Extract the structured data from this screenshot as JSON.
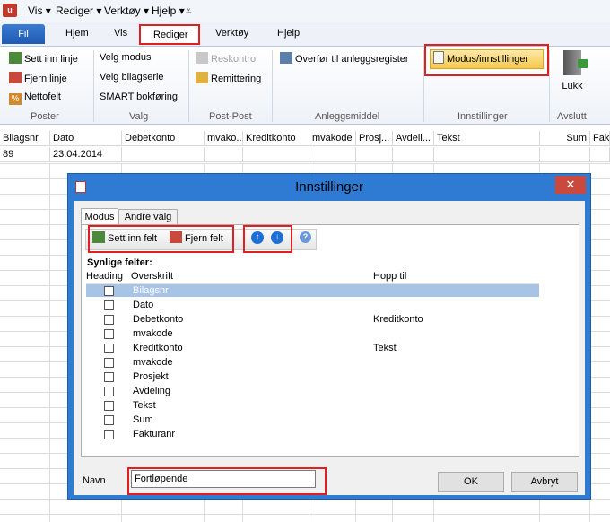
{
  "menu": {
    "vis": "Vis",
    "rediger": "Rediger",
    "verktoy": "Verktøy",
    "hjelp": "Hjelp"
  },
  "tabs": {
    "fil": "Fil",
    "hjem": "Hjem",
    "vis": "Vis",
    "rediger": "Rediger",
    "verktoy": "Verktøy",
    "hjelp": "Hjelp"
  },
  "ribbon": {
    "poster": {
      "label": "Poster",
      "sett_inn_linje": "Sett inn linje",
      "fjern_linje": "Fjern linje",
      "nettofelt": "Nettofelt"
    },
    "valg": {
      "label": "Valg",
      "velg_modus": "Velg modus",
      "velg_bilagserie": "Velg bilagserie",
      "smart": "SMART bokføring"
    },
    "post_post": {
      "label": "Post-Post",
      "reskontro": "Reskontro",
      "remittering": "Remittering"
    },
    "anleggsmiddel": {
      "label": "Anleggsmiddel",
      "overfor": "Overfør til anleggsregister"
    },
    "innstillinger": {
      "label": "Innstillinger",
      "modus": "Modus/innstillinger"
    },
    "avslutt": {
      "label": "Avslutt",
      "lukk": "Lukk"
    }
  },
  "grid": {
    "headers": [
      "Bilagsnr",
      "Dato",
      "Debetkonto",
      "mvako...",
      "Kreditkonto",
      "mvakode",
      "Prosj...",
      "Avdeli...",
      "Tekst",
      "Sum",
      "Fak"
    ],
    "row1": {
      "bilagsnr": "89",
      "dato": "23.04.2014"
    }
  },
  "dialog": {
    "title": "Innstillinger",
    "close": "✕",
    "tabs": {
      "modus": "Modus",
      "andre_valg": "Andre valg"
    },
    "toolbar": {
      "sett_inn_felt": "Sett inn felt",
      "fjern_felt": "Fjern felt"
    },
    "section": "Synlige felter:",
    "columns": {
      "heading": "Heading",
      "overskrift": "Overskrift",
      "hopp_til": "Hopp til"
    },
    "fields": [
      {
        "name": "Bilagsnr",
        "hopp": ""
      },
      {
        "name": "Dato",
        "hopp": ""
      },
      {
        "name": "Debetkonto",
        "hopp": "Kreditkonto"
      },
      {
        "name": "mvakode",
        "hopp": ""
      },
      {
        "name": "Kreditkonto",
        "hopp": "Tekst"
      },
      {
        "name": "mvakode",
        "hopp": ""
      },
      {
        "name": "Prosjekt",
        "hopp": ""
      },
      {
        "name": "Avdeling",
        "hopp": ""
      },
      {
        "name": "Tekst",
        "hopp": ""
      },
      {
        "name": "Sum",
        "hopp": ""
      },
      {
        "name": "Fakturanr",
        "hopp": ""
      }
    ],
    "navn_label": "Navn",
    "navn_value": "Fortløpende",
    "ok": "OK",
    "avbryt": "Avbryt"
  }
}
